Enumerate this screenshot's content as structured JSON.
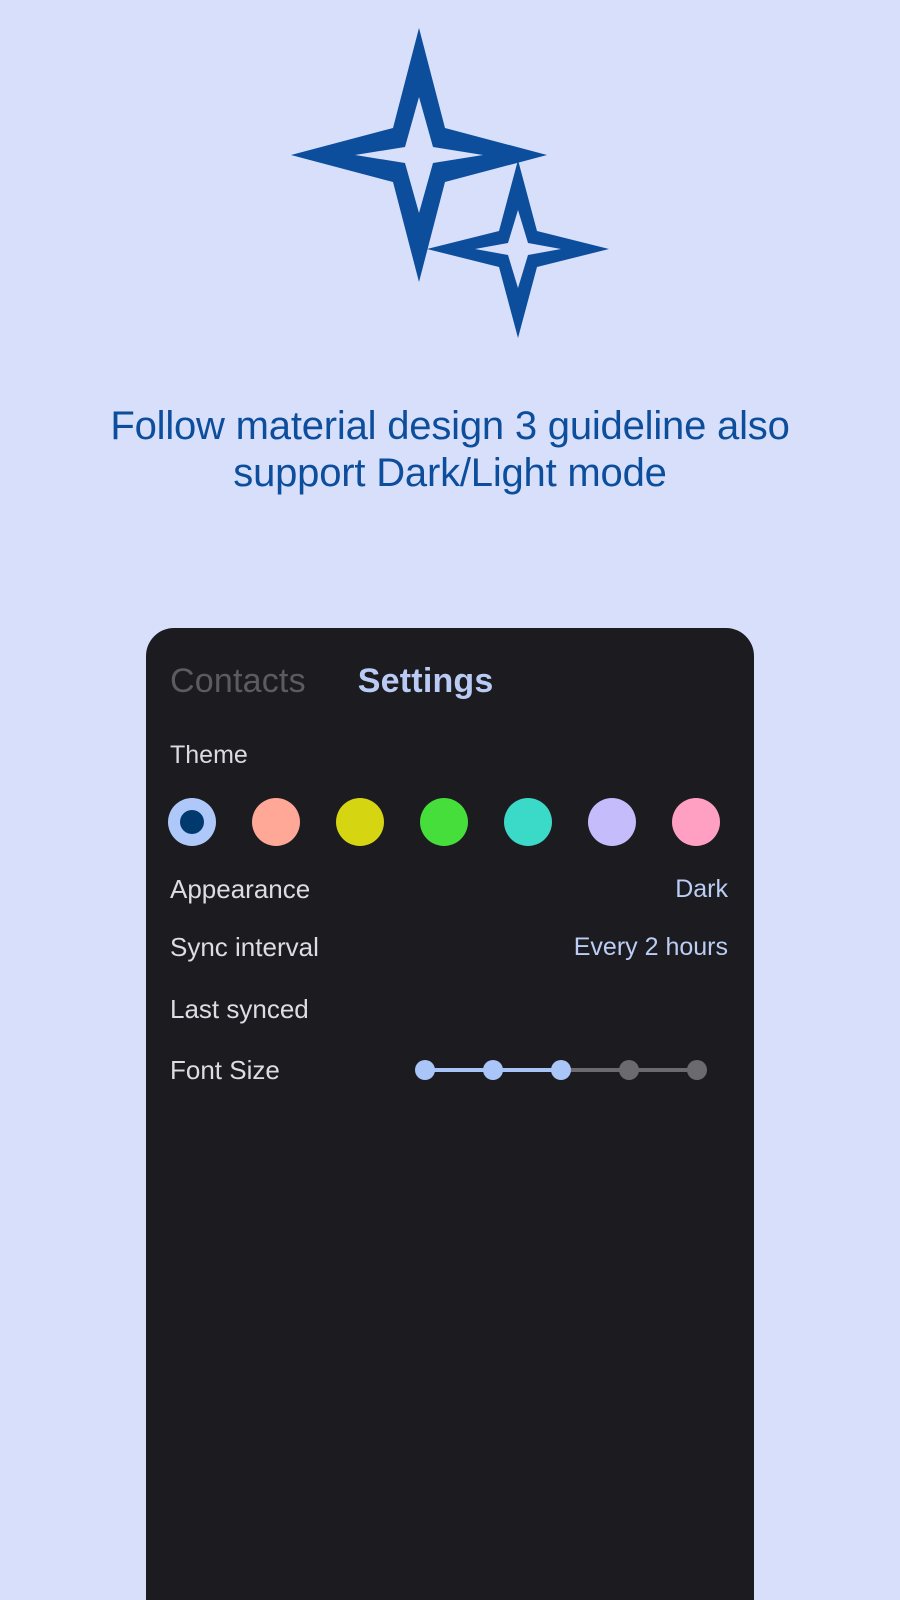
{
  "background_color": "#d7dffb",
  "hero": {
    "logo_icon": "double-sparkle-star-icon",
    "logo_color": "#0d4e9c",
    "tagline": "Follow material design 3 guideline also support Dark/Light mode",
    "tagline_color": "#0d4e9c"
  },
  "app": {
    "card_background": "#1c1c20",
    "tabs": [
      {
        "label": "Contacts",
        "active": false,
        "color": "#5c5c60"
      },
      {
        "label": "Settings",
        "active": true,
        "color": "#b9cbf4"
      }
    ],
    "theme": {
      "label": "Theme",
      "selected_index": 0,
      "swatches": [
        {
          "name": "blue",
          "color": "#aec8fa",
          "inner_color": "#00396e",
          "selected": true
        },
        {
          "name": "salmon",
          "color": "#ffa898",
          "selected": false
        },
        {
          "name": "yellow",
          "color": "#d5d511",
          "selected": false
        },
        {
          "name": "green",
          "color": "#45de3b",
          "selected": false
        },
        {
          "name": "teal",
          "color": "#3bd9c7",
          "selected": false
        },
        {
          "name": "lavender",
          "color": "#c5bdfb",
          "selected": false
        },
        {
          "name": "pink",
          "color": "#ffa0c3",
          "selected": false
        }
      ]
    },
    "rows": [
      {
        "label": "Appearance",
        "value": "Dark"
      },
      {
        "label": "Sync interval",
        "value": "Every 2 hours"
      },
      {
        "label": "Last synced",
        "value": ""
      }
    ],
    "font_size": {
      "label": "Font Size",
      "ticks": 5,
      "value": 3,
      "active_color": "#aac5f7",
      "inactive_color": "#6b6b6f"
    }
  }
}
